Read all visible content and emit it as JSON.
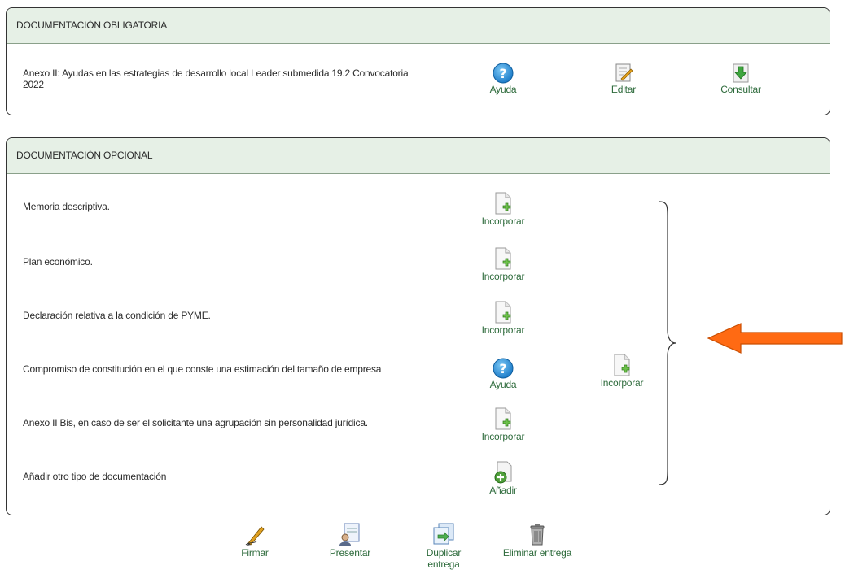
{
  "mandatory": {
    "header": "DOCUMENTACIÓN OBLIGATORIA",
    "item_text": "Anexo II: Ayudas en las estrategias de desarrollo local Leader submedida 19.2 Convocatoria 2022",
    "help_label": "Ayuda",
    "edit_label": "Editar",
    "view_label": "Consultar"
  },
  "optional": {
    "header": "DOCUMENTACIÓN OPCIONAL",
    "items": [
      {
        "text": "Memoria descriptiva.",
        "action": "Incorporar"
      },
      {
        "text": "Plan económico.",
        "action": "Incorporar"
      },
      {
        "text": "Declaración relativa a la condición de PYME.",
        "action": "Incorporar"
      },
      {
        "text": "Compromiso de constitución en el que conste una estimación del tamaño de empresa",
        "help": "Ayuda",
        "action": "Incorporar"
      },
      {
        "text": "Anexo II Bis, en caso de ser el solicitante una agrupación sin personalidad jurídica.",
        "action": "Incorporar"
      },
      {
        "text": "Añadir otro tipo de documentación",
        "action": "Añadir"
      }
    ]
  },
  "footer": {
    "sign": "Firmar",
    "submit": "Presentar",
    "duplicate_line1": "Duplicar",
    "duplicate_line2": "entrega",
    "delete": "Eliminar entrega"
  },
  "colors": {
    "header_bg": "#e6f0e6",
    "link_green": "#2e6b3c",
    "arrow": "#ff6a13"
  }
}
